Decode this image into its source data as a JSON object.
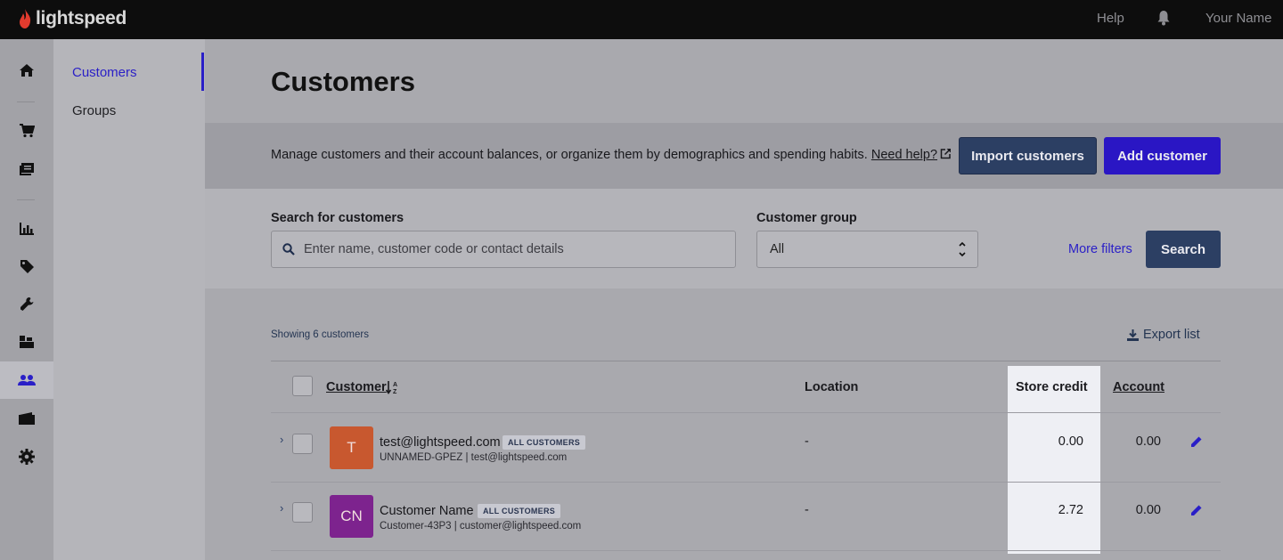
{
  "topbar": {
    "brand": "lightspeed",
    "help": "Help",
    "user": "Your Name"
  },
  "colors": {
    "accent": "#2a1fc7",
    "brand_red": "#e23b2e",
    "primary_button": "#2a16c4",
    "secondary_button": "#2c3f63",
    "avatar_orange": "#c8582f",
    "avatar_purple": "#7d238e"
  },
  "rail": {
    "icons": [
      "home-icon",
      "cart-icon",
      "catalog-icon",
      "reports-icon",
      "tag-icon",
      "wrench-icon",
      "inventory-icon",
      "customers-icon",
      "wallet-icon",
      "gear-icon"
    ],
    "active": "customers-icon"
  },
  "subnav": {
    "items": [
      {
        "label": "Customers",
        "active": true
      },
      {
        "label": "Groups",
        "active": false
      }
    ]
  },
  "page": {
    "title": "Customers",
    "description": "Manage customers and their account balances, or organize them by demographics and spending habits.",
    "help_link": "Need help?",
    "import_button": "Import customers",
    "add_button": "Add customer"
  },
  "search": {
    "label": "Search for customers",
    "placeholder": "Enter name, customer code or contact details",
    "group_label": "Customer group",
    "group_value": "All",
    "more_filters": "More filters",
    "search_button": "Search"
  },
  "results": {
    "showing": "Showing 6 customers",
    "export": "Export list",
    "columns": {
      "customer": "Customer",
      "location": "Location",
      "store_credit": "Store credit",
      "account": "Account"
    },
    "rows": [
      {
        "initials": "T",
        "name": "test@lightspeed.com",
        "badge": "ALL CUSTOMERS",
        "sub": "UNNAMED-GPEZ | test@lightspeed.com",
        "location": "-",
        "store_credit": "0.00",
        "account": "0.00"
      },
      {
        "initials": "CN",
        "name": "Customer Name",
        "badge": "ALL CUSTOMERS",
        "sub": "Customer-43P3 | customer@lightspeed.com",
        "location": "-",
        "store_credit": "2.72",
        "account": "0.00"
      }
    ]
  }
}
